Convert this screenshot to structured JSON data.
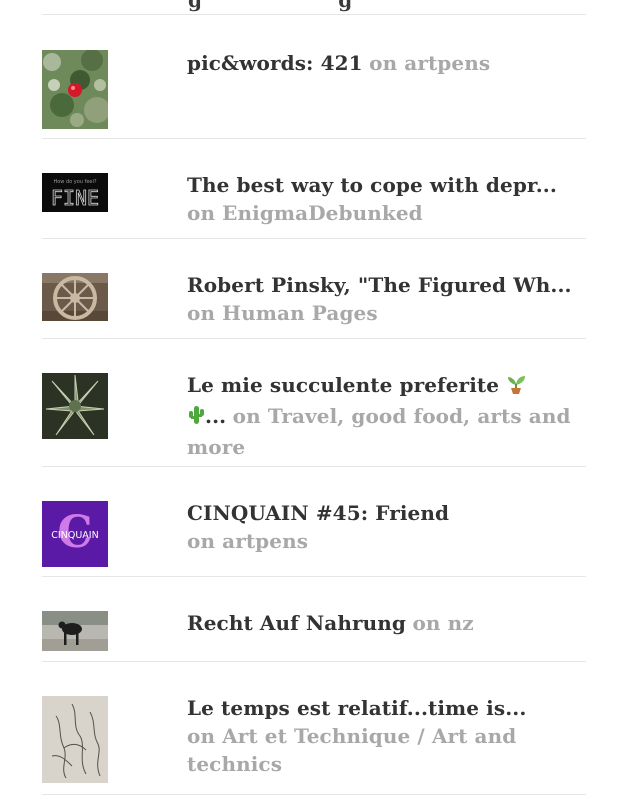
{
  "posts": [
    {
      "title": "pic&words: 421",
      "site": "on artpens"
    },
    {
      "title": "The best way to cope with depr...",
      "site": "on EnigmaDebunked"
    },
    {
      "title": "Robert Pinsky, \"The Figured Wh...",
      "site": "on Human Pages"
    },
    {
      "title": "Le mie succulente preferite",
      "title_tail": "...",
      "site": "on Travel, good food, arts and more"
    },
    {
      "title": "CINQUAIN #45: Friend",
      "site": "on artpens"
    },
    {
      "title": "Recht Auf Nahrung",
      "site": "on nz"
    },
    {
      "title": "Le temps est relatif...time is...",
      "site": "on Art et Technique / Art and technics"
    }
  ],
  "thumbnails": {
    "fine_text": "FINE",
    "fine_small": "How do you feel?",
    "cinquain_text": "CINQUAIN",
    "cinquain_letter": "C"
  },
  "colors": {
    "title": "#333333",
    "site": "#a8a8a8",
    "divider": "#e6e6e6",
    "cinquain_bg": "#5b1aa6"
  }
}
